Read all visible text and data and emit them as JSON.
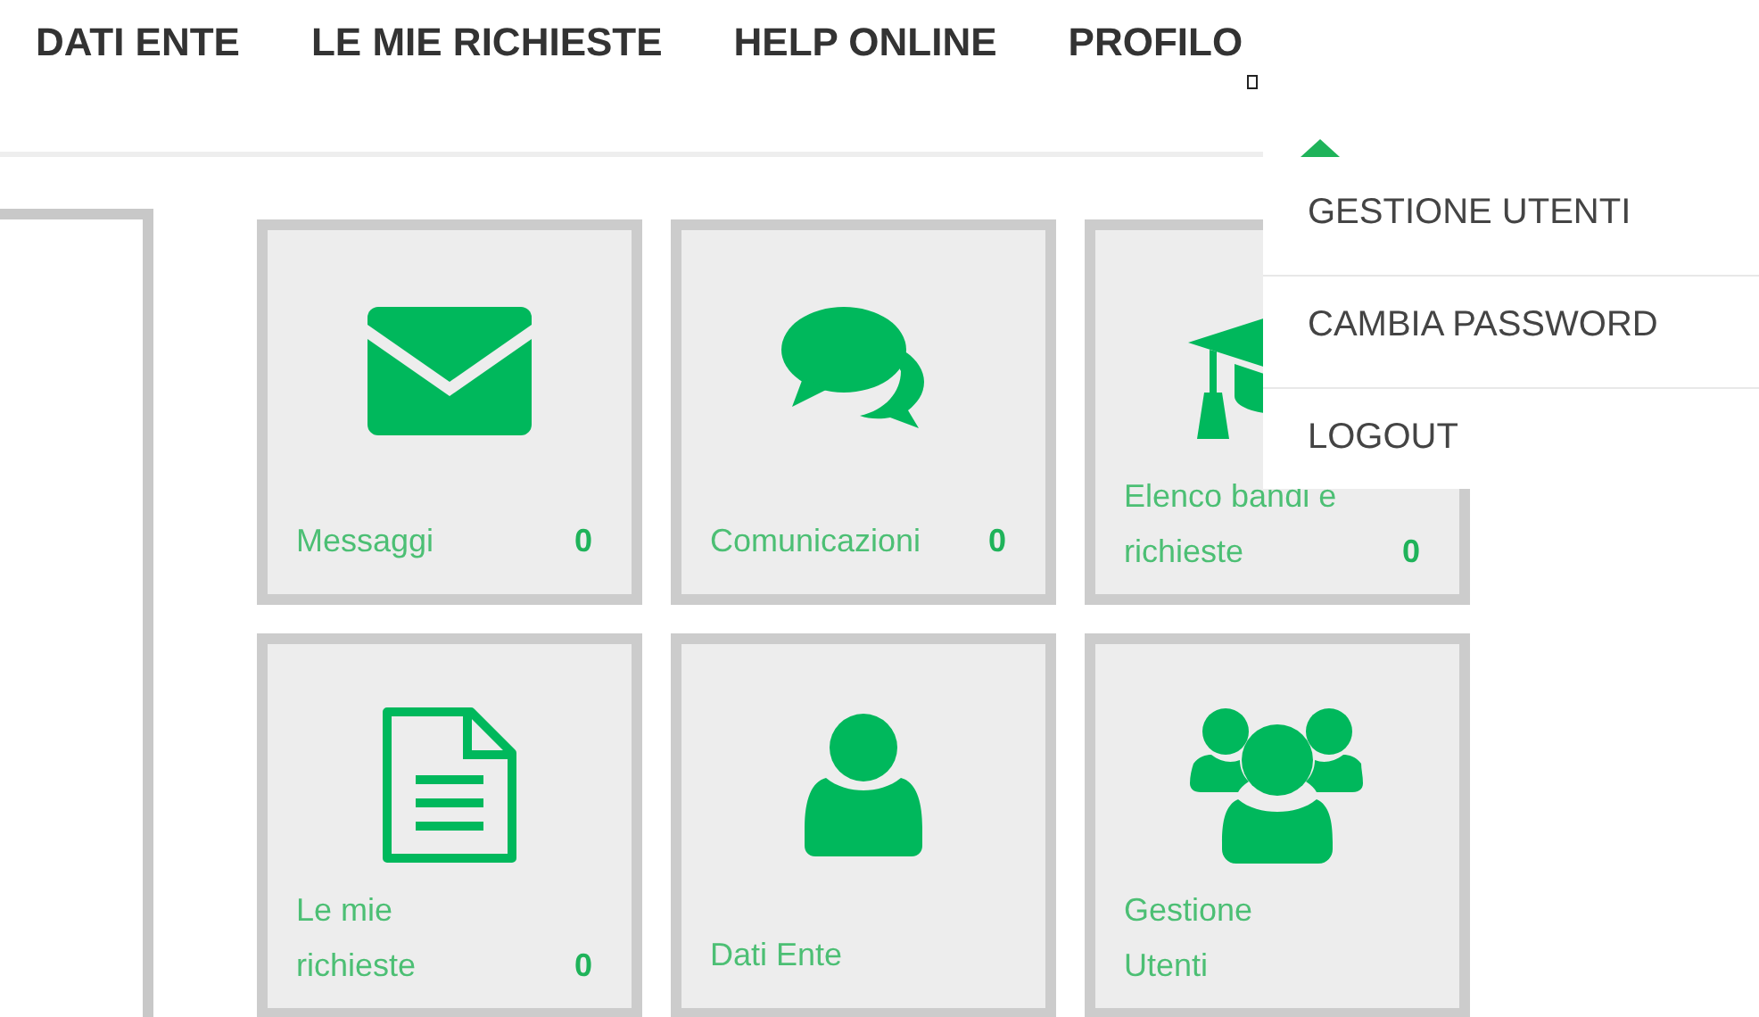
{
  "nav": [
    {
      "label": "DATI ENTE"
    },
    {
      "label": "LE MIE RICHIESTE"
    },
    {
      "label": "HELP ONLINE"
    },
    {
      "label": "PROFILO",
      "expanded": true
    }
  ],
  "profile_menu": [
    {
      "label": "GESTIONE UTENTI"
    },
    {
      "label": "CAMBIA PASSWORD"
    },
    {
      "label": "LOGOUT"
    }
  ],
  "tiles": [
    {
      "kind": "envelope",
      "label": "Messaggi",
      "count": "0"
    },
    {
      "kind": "chat",
      "label": "Comunicazioni",
      "count": "0"
    },
    {
      "kind": "cap",
      "label": "Elenco bandi e richieste",
      "count": "0"
    },
    {
      "kind": "document",
      "label": "Le mie richieste",
      "count": "0"
    },
    {
      "kind": "person",
      "label": "Dati Ente"
    },
    {
      "kind": "group",
      "label": "Gestione Utenti"
    }
  ]
}
